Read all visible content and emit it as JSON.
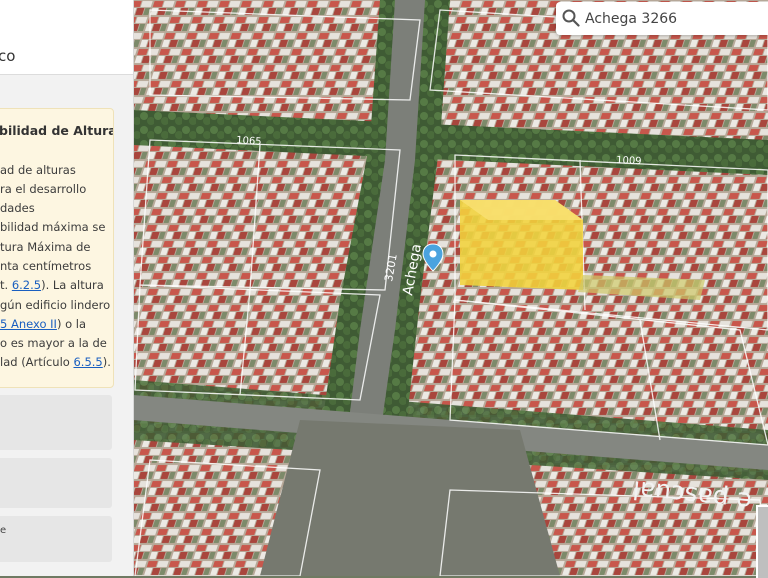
{
  "panel": {
    "header_title": "co",
    "card": {
      "title": "bilidad de Altura",
      "lines": [
        {
          "text": "ad de alturas"
        },
        {
          "text": "ra el desarrollo"
        },
        {
          "text": "dades"
        },
        {
          "text": "bilidad máxima se"
        },
        {
          "text": "tura Máxima de"
        },
        {
          "text": "nta centímetros"
        },
        {
          "pre": "t. ",
          "link": "6.2.5",
          "post": "). La altura"
        },
        {
          "text": "gún edificio lindero"
        },
        {
          "pre": "",
          "link": "5 Anexo II",
          "post": ") o la"
        },
        {
          "text": "o es mayor a la de"
        },
        {
          "pre": "lad (Artículo ",
          "link": "6.5.5",
          "post": ")."
        }
      ]
    },
    "box3_text": "e"
  },
  "search": {
    "value": "Achega 3266"
  },
  "map": {
    "street_labels": [
      "1065",
      "1009",
      "3201",
      "Achega",
      "e pascual"
    ]
  },
  "colors": {
    "highlight_building": "#f3d33c",
    "pin": "#4aa3df",
    "card_bg": "#fdf6e1",
    "link": "#1a5fc0"
  }
}
